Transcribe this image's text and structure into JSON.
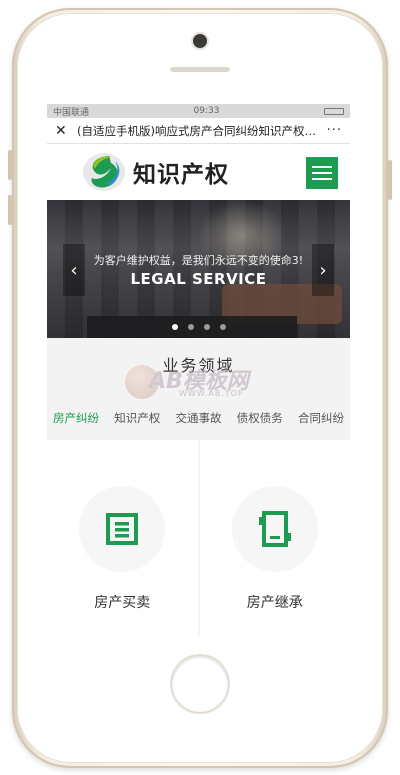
{
  "status_bar": {
    "carrier": "中国联通",
    "time": "09:33"
  },
  "browser_bar": {
    "close_icon": "close-icon",
    "title": "(自适应手机版)响应式房产合同纠纷知识产权类网站",
    "more_label": "···"
  },
  "header": {
    "logo_text": "知识产权",
    "menu_icon": "hamburger-icon",
    "accent_color": "#1d9b50"
  },
  "banner": {
    "subtitle": "为客户维护权益，是我们永远不变的使命3!",
    "title": "LEGAL SERVICE",
    "prev_label": "‹",
    "next_label": "›",
    "slide_count": 4,
    "active_slide": 1
  },
  "section": {
    "title": "业务领域"
  },
  "watermark": {
    "big": "AB模板网",
    "small": "WWW.AB.TOP"
  },
  "tabs": [
    {
      "label": "房产纠纷",
      "active": true
    },
    {
      "label": "知识产权",
      "active": false
    },
    {
      "label": "交通事故",
      "active": false
    },
    {
      "label": "债权债务",
      "active": false
    },
    {
      "label": "合同纠纷",
      "active": false
    }
  ],
  "cards": [
    {
      "label": "房产买卖",
      "icon": "building-icon"
    },
    {
      "label": "房产继承",
      "icon": "document-icon"
    }
  ]
}
